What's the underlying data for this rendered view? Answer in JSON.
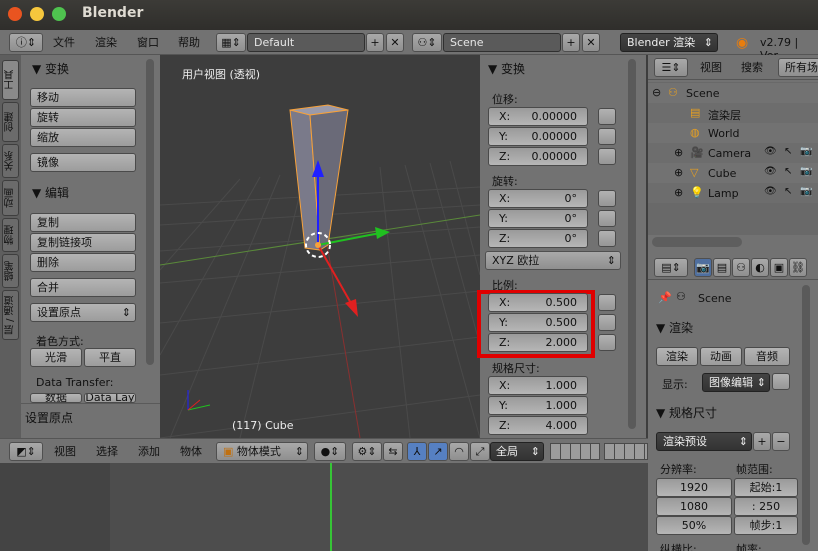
{
  "window": {
    "title": "Blender"
  },
  "infobar": {
    "menus": [
      "文件",
      "渲染",
      "窗口",
      "帮助"
    ],
    "screen": "Default",
    "scene": "Scene",
    "engine": "Blender 渲染",
    "version": "v2.79 | Ver"
  },
  "tabs": [
    "工具",
    "创建",
    "关系",
    "动画",
    "物理",
    "蜡笔",
    "层 / 通道"
  ],
  "toolshelf": {
    "transform_header": "▼ 变换",
    "transform_buttons": [
      "移动",
      "旋转",
      "缩放"
    ],
    "mirror": "镜像",
    "edit_header": "▼ 编辑",
    "edit_buttons": [
      "复制",
      "复制链接项",
      "删除"
    ],
    "join": "合并",
    "set_origin": "设置原点",
    "shading_label": "着色方式:",
    "smooth": "光滑",
    "flat": "平直",
    "data_transfer": "Data Transfer:",
    "data": "数据",
    "data_lay": "Data Lay",
    "last_op": "▼ 设置原点"
  },
  "viewport": {
    "view_label": "用户视图 (透视)",
    "object_label": "(117) Cube"
  },
  "nprops": {
    "header": "▼ 变换",
    "location": "位移:",
    "loc": [
      {
        "axis": "X:",
        "val": "0.00000"
      },
      {
        "axis": "Y:",
        "val": "0.00000"
      },
      {
        "axis": "Z:",
        "val": "0.00000"
      }
    ],
    "rotation": "旋转:",
    "rot": [
      {
        "axis": "X:",
        "val": "0°"
      },
      {
        "axis": "Y:",
        "val": "0°"
      },
      {
        "axis": "Z:",
        "val": "0°"
      }
    ],
    "rot_mode": "XYZ 欧拉",
    "scale": "比例:",
    "scl": [
      {
        "axis": "X:",
        "val": "0.500"
      },
      {
        "axis": "Y:",
        "val": "0.500"
      },
      {
        "axis": "Z:",
        "val": "2.000"
      }
    ],
    "dims": "规格尺寸:",
    "dim": [
      {
        "axis": "X:",
        "val": "1.000"
      },
      {
        "axis": "Y:",
        "val": "1.000"
      },
      {
        "axis": "Z:",
        "val": "4.000"
      }
    ],
    "highlight_color": "#e00000"
  },
  "outliner": {
    "menus": [
      "视图",
      "搜索",
      "所有场"
    ],
    "items": [
      {
        "name": "Scene",
        "indent": 0
      },
      {
        "name": "渲染层",
        "indent": 1
      },
      {
        "name": "World",
        "indent": 1
      },
      {
        "name": "Camera",
        "indent": 1
      },
      {
        "name": "Cube",
        "indent": 1
      },
      {
        "name": "Lamp",
        "indent": 1
      }
    ]
  },
  "props": {
    "scene": "Scene",
    "render_header": "▼ 渲染",
    "render_btn": "渲染",
    "anim_btn": "动画",
    "audio_btn": "音频",
    "display": "显示:",
    "display_val": "图像编辑",
    "dims_header": "▼ 规格尺寸",
    "preset": "渲染预设",
    "resolution": "分辨率:",
    "res_x": "1920",
    "res_y": "1080",
    "res_pct": "50%",
    "frame_range": "帧范围:",
    "start": "起始:1",
    "end": ":   250",
    "step": "帧步:1",
    "aspect": "纵横比:",
    "fps": "帧率:"
  },
  "view3d_header": {
    "menus": [
      "视图",
      "选择",
      "添加",
      "物体"
    ],
    "mode": "物体模式",
    "pivot": "全局"
  }
}
